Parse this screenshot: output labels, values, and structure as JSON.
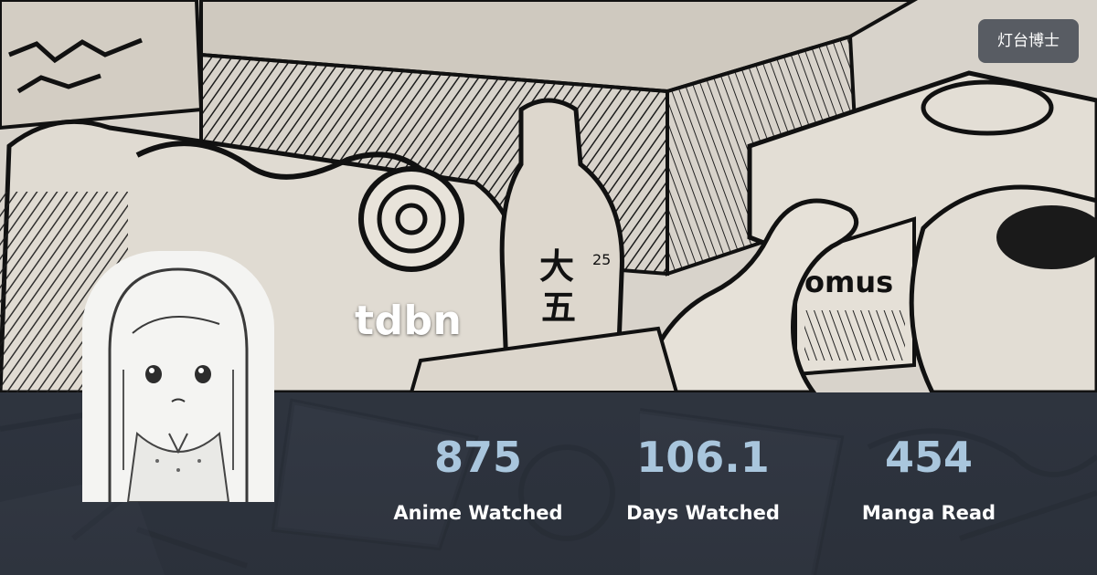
{
  "profile": {
    "username": "tdbn",
    "site_badge": "灯台博士"
  },
  "stats": [
    {
      "value": "875",
      "label": "Anime Watched"
    },
    {
      "value": "106.1",
      "label": "Days Watched"
    },
    {
      "value": "454",
      "label": "Manga Read"
    }
  ],
  "colors": {
    "stat_value": "#a9c6dd",
    "stat_label": "#ffffff",
    "stats_background": "#2f3540",
    "banner_paper": "#d8d3cb"
  }
}
